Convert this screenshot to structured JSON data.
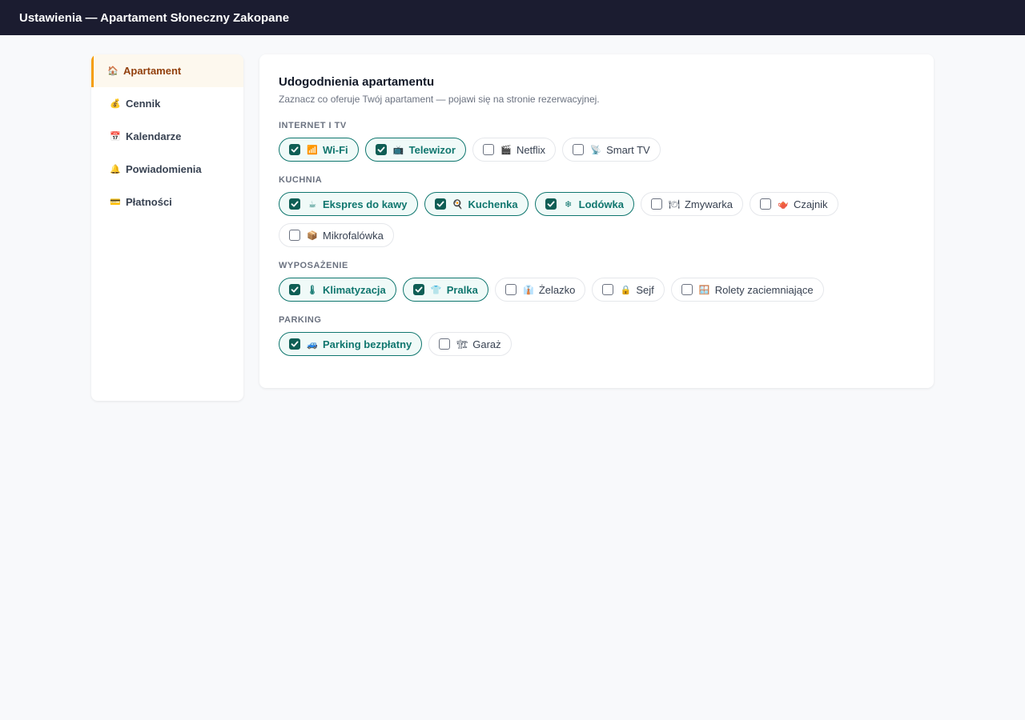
{
  "header": {
    "title": "Ustawienia — Apartament Słoneczny Zakopane"
  },
  "sidebar": {
    "items": [
      {
        "label": "Apartament",
        "icon": "house-icon",
        "glyph": "🏠",
        "active": true
      },
      {
        "label": "Cennik",
        "icon": "money-bag-icon",
        "glyph": "💰",
        "active": false
      },
      {
        "label": "Kalendarze",
        "icon": "calendar-icon",
        "glyph": "📅",
        "active": false
      },
      {
        "label": "Powiadomienia",
        "icon": "bell-icon",
        "glyph": "🔔",
        "active": false
      },
      {
        "label": "Płatności",
        "icon": "credit-card-icon",
        "glyph": "💳",
        "active": false
      }
    ]
  },
  "main": {
    "title": "Udogodnienia apartamentu",
    "subtitle": "Zaznacz co oferuje Twój apartament — pojawi się na stronie rezerwacyjnej.",
    "sections": [
      {
        "title": "INTERNET I TV",
        "items": [
          {
            "label": "Wi-Fi",
            "icon": "signal-icon",
            "glyph": "📶",
            "checked": true
          },
          {
            "label": "Telewizor",
            "icon": "tv-icon",
            "glyph": "📺",
            "checked": true
          },
          {
            "label": "Netflix",
            "icon": "clapper-icon",
            "glyph": "🎬",
            "checked": false
          },
          {
            "label": "Smart TV",
            "icon": "satellite-icon",
            "glyph": "📡",
            "checked": false
          }
        ]
      },
      {
        "title": "KUCHNIA",
        "items": [
          {
            "label": "Ekspres do kawy",
            "icon": "coffee-icon",
            "glyph": "☕",
            "checked": true
          },
          {
            "label": "Kuchenka",
            "icon": "frying-pan-icon",
            "glyph": "🍳",
            "checked": true
          },
          {
            "label": "Lodówka",
            "icon": "snowflake-icon",
            "glyph": "❄",
            "checked": true
          },
          {
            "label": "Zmywarka",
            "icon": "dishes-icon",
            "glyph": "🍽",
            "checked": false
          },
          {
            "label": "Czajnik",
            "icon": "teapot-icon",
            "glyph": "🫖",
            "checked": false
          },
          {
            "label": "Mikrofalówka",
            "icon": "box-icon",
            "glyph": "📦",
            "checked": false
          }
        ]
      },
      {
        "title": "WYPOSAŻENIE",
        "items": [
          {
            "label": "Klimatyzacja",
            "icon": "thermometer-icon",
            "glyph": "🌡",
            "checked": true
          },
          {
            "label": "Pralka",
            "icon": "shirt-icon",
            "glyph": "👕",
            "checked": true
          },
          {
            "label": "Żelazko",
            "icon": "iron-icon",
            "glyph": "👔",
            "checked": false
          },
          {
            "label": "Sejf",
            "icon": "lock-icon",
            "glyph": "🔒",
            "checked": false
          },
          {
            "label": "Rolety zaciemniające",
            "icon": "window-icon",
            "glyph": "🪟",
            "checked": false
          }
        ]
      },
      {
        "title": "PARKING",
        "items": [
          {
            "label": "Parking bezpłatny",
            "icon": "car-icon",
            "glyph": "🚙",
            "checked": true
          },
          {
            "label": "Garaż",
            "icon": "garage-icon",
            "glyph": "🏗",
            "checked": false
          }
        ]
      }
    ]
  },
  "colors": {
    "topbar": "#1b1c30",
    "accent_active": "#f59e0b",
    "checked": "#0f766e"
  }
}
